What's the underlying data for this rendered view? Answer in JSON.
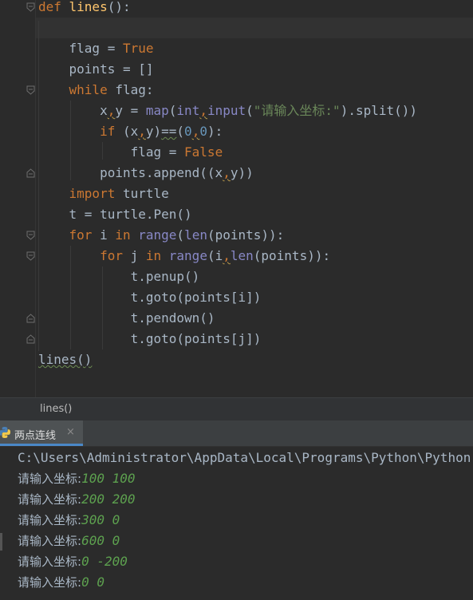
{
  "editor": {
    "lines": [
      {
        "segments": [
          {
            "t": "def ",
            "c": "kw"
          },
          {
            "t": "lines",
            "c": "fn"
          },
          {
            "t": "():",
            "c": "plain"
          }
        ]
      },
      {
        "segments": []
      },
      {
        "segments": [
          {
            "t": "    flag = ",
            "c": "plain"
          },
          {
            "t": "True",
            "c": "kw"
          }
        ]
      },
      {
        "segments": [
          {
            "t": "    points = []",
            "c": "plain"
          }
        ]
      },
      {
        "segments": [
          {
            "t": "    ",
            "c": "plain"
          },
          {
            "t": "while",
            "c": "kw"
          },
          {
            "t": " flag:",
            "c": "plain"
          }
        ]
      },
      {
        "segments": [
          {
            "t": "        x",
            "c": "plain"
          },
          {
            "t": ",",
            "c": "kw squig"
          },
          {
            "t": "y = ",
            "c": "plain"
          },
          {
            "t": "map",
            "c": "bi"
          },
          {
            "t": "(",
            "c": "plain"
          },
          {
            "t": "int",
            "c": "bi"
          },
          {
            "t": ",",
            "c": "kw squig"
          },
          {
            "t": "input",
            "c": "bi"
          },
          {
            "t": "(",
            "c": "plain"
          },
          {
            "t": "\"请输入坐标:\"",
            "c": "str"
          },
          {
            "t": ").split())",
            "c": "plain"
          }
        ]
      },
      {
        "segments": [
          {
            "t": "        ",
            "c": "plain"
          },
          {
            "t": "if",
            "c": "kw"
          },
          {
            "t": " (x",
            "c": "plain"
          },
          {
            "t": ",",
            "c": "kw squig"
          },
          {
            "t": "y)",
            "c": "plain"
          },
          {
            "t": "==",
            "c": "plain squig-green"
          },
          {
            "t": "(",
            "c": "plain"
          },
          {
            "t": "0",
            "c": "num"
          },
          {
            "t": ",",
            "c": "kw squig"
          },
          {
            "t": "0",
            "c": "num"
          },
          {
            "t": "):",
            "c": "plain"
          }
        ]
      },
      {
        "segments": [
          {
            "t": "            flag = ",
            "c": "plain"
          },
          {
            "t": "False",
            "c": "kw"
          }
        ]
      },
      {
        "segments": [
          {
            "t": "        points.append((x",
            "c": "plain"
          },
          {
            "t": ",",
            "c": "kw squig"
          },
          {
            "t": "y))",
            "c": "plain"
          }
        ]
      },
      {
        "segments": [
          {
            "t": "    ",
            "c": "plain"
          },
          {
            "t": "import",
            "c": "kw"
          },
          {
            "t": " turtle",
            "c": "plain"
          }
        ]
      },
      {
        "segments": [
          {
            "t": "    t = turtle.Pen()",
            "c": "plain"
          }
        ]
      },
      {
        "segments": [
          {
            "t": "    ",
            "c": "plain"
          },
          {
            "t": "for",
            "c": "kw"
          },
          {
            "t": " i ",
            "c": "plain"
          },
          {
            "t": "in",
            "c": "kw"
          },
          {
            "t": " ",
            "c": "plain"
          },
          {
            "t": "range",
            "c": "bi"
          },
          {
            "t": "(",
            "c": "plain"
          },
          {
            "t": "len",
            "c": "bi"
          },
          {
            "t": "(points)):",
            "c": "plain"
          }
        ]
      },
      {
        "segments": [
          {
            "t": "        ",
            "c": "plain"
          },
          {
            "t": "for",
            "c": "kw"
          },
          {
            "t": " j ",
            "c": "plain"
          },
          {
            "t": "in",
            "c": "kw"
          },
          {
            "t": " ",
            "c": "plain"
          },
          {
            "t": "range",
            "c": "bi"
          },
          {
            "t": "(i",
            "c": "plain"
          },
          {
            "t": ",",
            "c": "kw squig"
          },
          {
            "t": "len",
            "c": "bi"
          },
          {
            "t": "(points)):",
            "c": "plain"
          }
        ]
      },
      {
        "segments": [
          {
            "t": "            t.penup()",
            "c": "plain"
          }
        ]
      },
      {
        "segments": [
          {
            "t": "            t.goto(points[i])",
            "c": "plain"
          }
        ]
      },
      {
        "segments": [
          {
            "t": "            t.pendown()",
            "c": "plain"
          }
        ]
      },
      {
        "segments": [
          {
            "t": "            t.goto(points[j])",
            "c": "plain"
          }
        ]
      },
      {
        "segments": [
          {
            "t": "lines()",
            "c": "plain squig-green"
          }
        ]
      }
    ]
  },
  "breadcrumb": {
    "text": "lines()"
  },
  "run_tab": {
    "label": "两点连线",
    "close": "×"
  },
  "console": {
    "command": "C:\\Users\\Administrator\\AppData\\Local\\Programs\\Python\\Python",
    "prompt": "请输入坐标:",
    "inputs": [
      "100 100",
      "200 200",
      "300 0",
      "600 0",
      "0 -200",
      "0 0"
    ]
  },
  "colors": {
    "keyword": "#cc7832",
    "function": "#ffc66d",
    "builtin": "#8888c6",
    "string": "#6a8759",
    "number": "#6897bb",
    "input": "#5da14f",
    "tab_accent": "#4a88c7"
  }
}
